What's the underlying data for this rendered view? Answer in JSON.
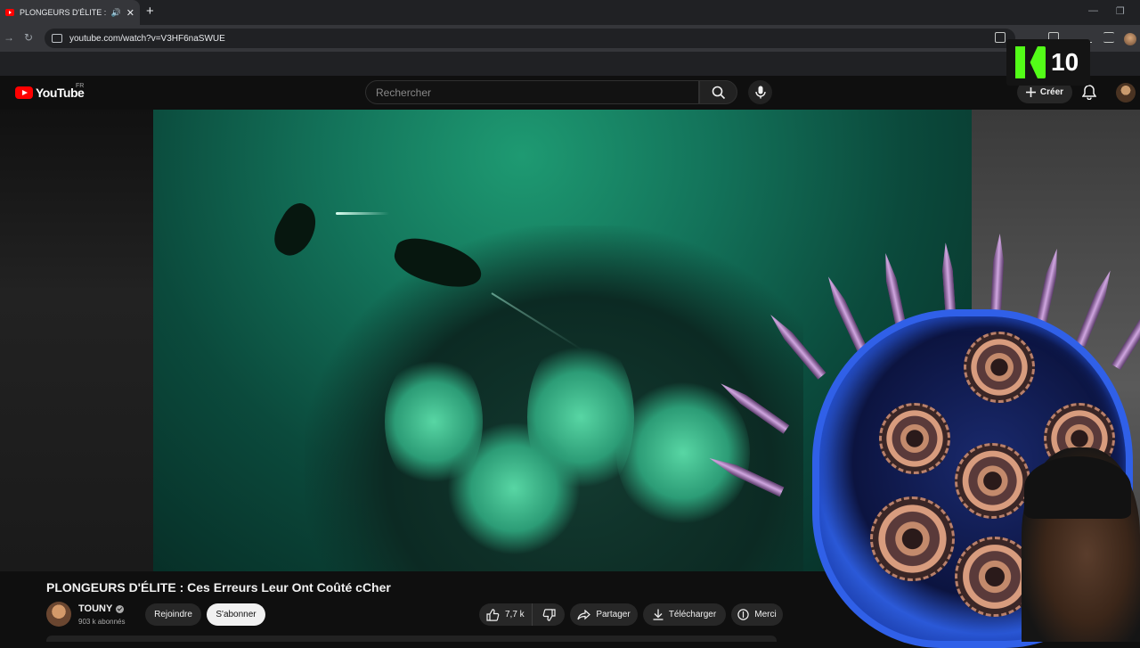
{
  "browser": {
    "tab_title": "PLONGEURS D'ÉLITE : Ces E",
    "tab_close": "✕",
    "new_tab": "+",
    "url": "youtube.com/watch?v=V3HF6naSWUE",
    "back": "←",
    "forward": "→",
    "reload": "↻",
    "minimize": "—",
    "restore": "❐"
  },
  "youtube": {
    "logo_text": "YouTube",
    "country": "FR",
    "search_placeholder": "Rechercher",
    "create_label": "Créer"
  },
  "overlay": {
    "kick_viewers": "10"
  },
  "video": {
    "title": "PLONGEURS D'ÉLITE : Ces Erreurs Leur Ont Coûté cCher",
    "channel_name": "TOUNY",
    "subscribers": "903 k abonnés",
    "join_label": "Rejoindre",
    "subscribe_label": "S'abonner",
    "likes": "7,7 k",
    "share_label": "Partager",
    "download_label": "Télécharger",
    "thanks_label": "Merci"
  },
  "colors": {
    "background": "#0f0f0f",
    "youtube_red": "#ff0000",
    "kick_green": "#53fc18",
    "pill_dark": "#272727",
    "pill_light": "#f1f1f1",
    "water_green": "#13735a"
  },
  "icons": [
    "search-icon",
    "mic-icon",
    "plus-icon",
    "bell-icon",
    "like-icon",
    "dislike-icon",
    "share-icon",
    "download-icon",
    "thanks-icon",
    "verified-icon",
    "audio-icon"
  ]
}
